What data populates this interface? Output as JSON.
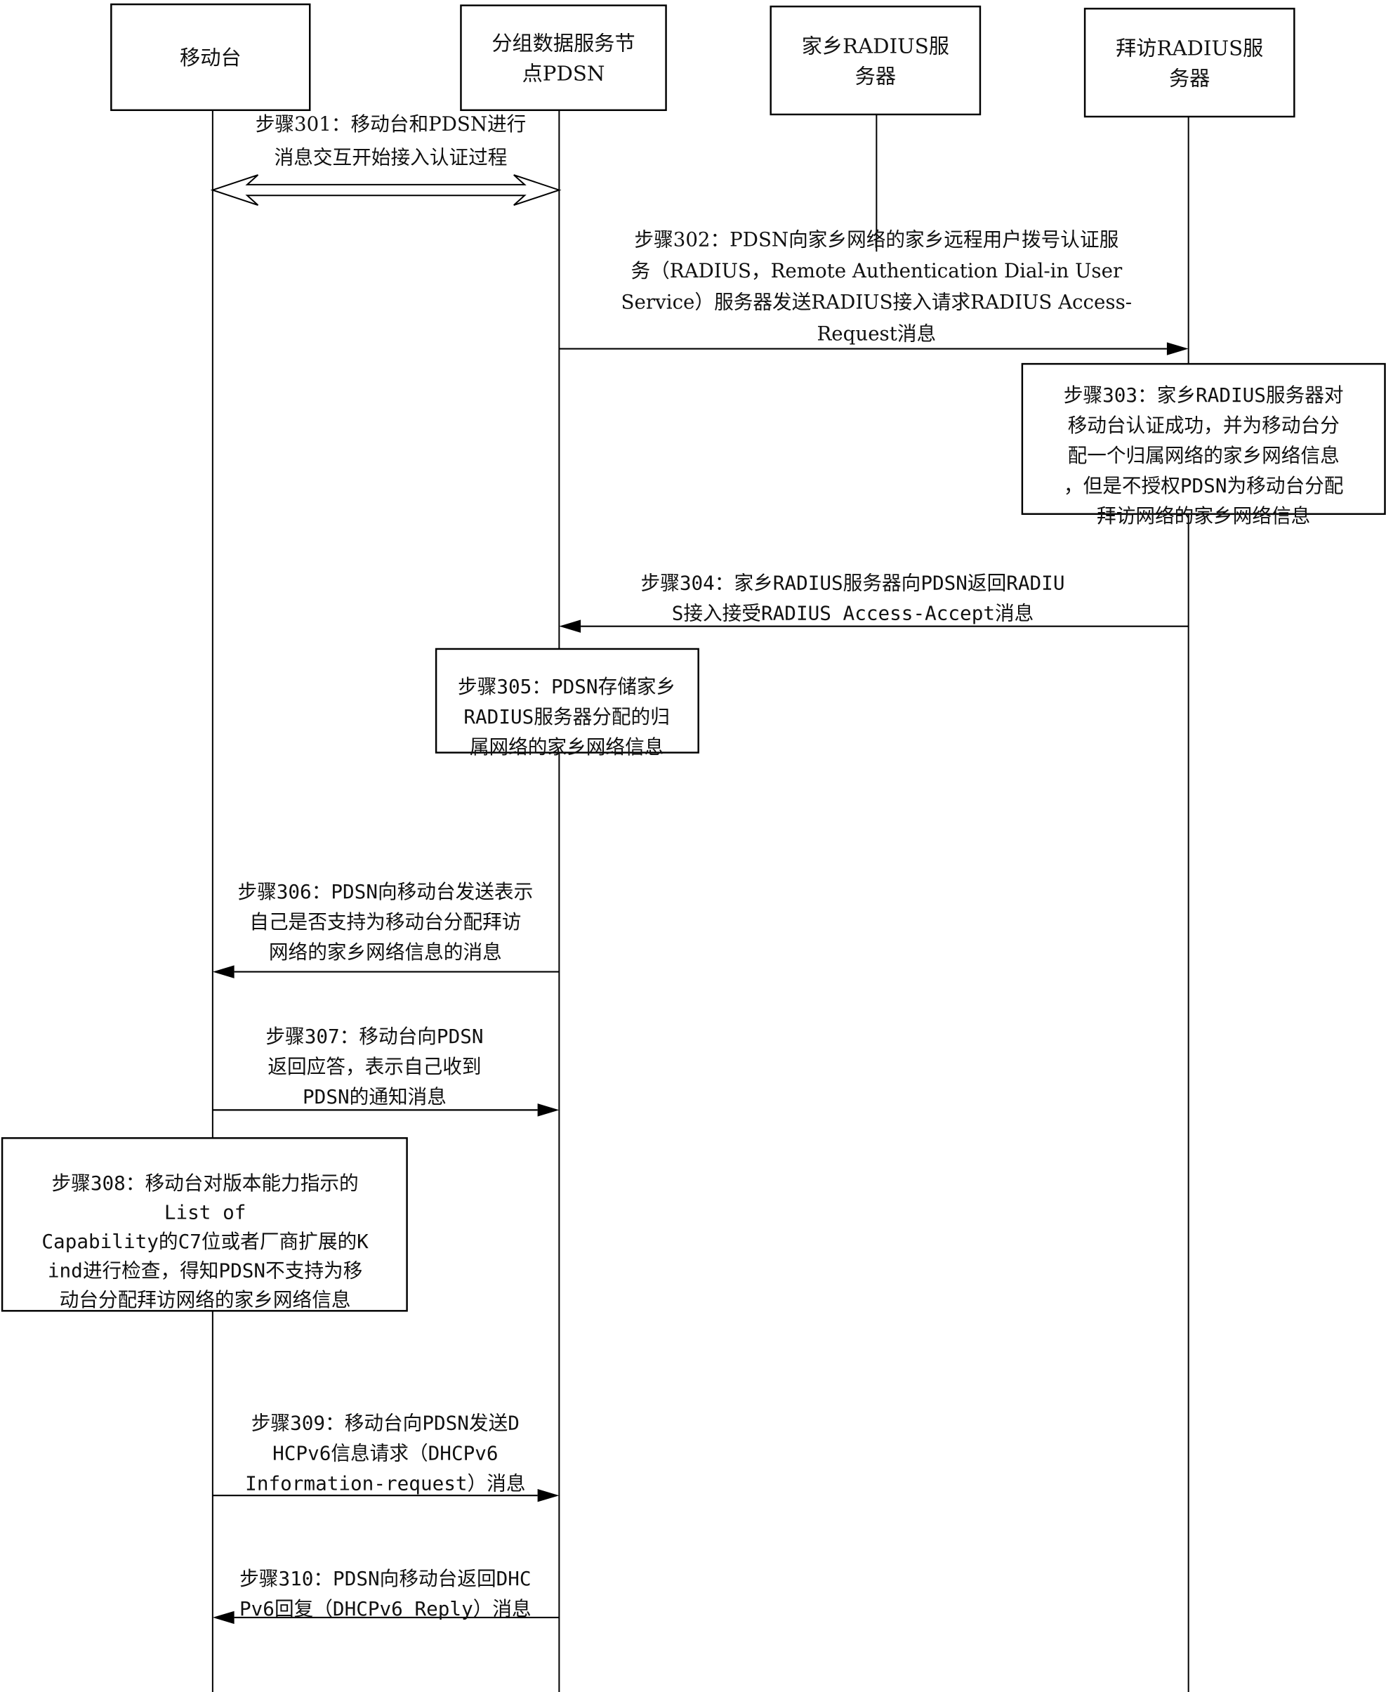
{
  "diagram": {
    "type": "sequence",
    "colors": {
      "line": "#000000",
      "background": "#ffffff",
      "text": "#111111"
    },
    "actors": [
      {
        "id": "ms",
        "lines": [
          "移动台"
        ]
      },
      {
        "id": "pdsn",
        "lines": [
          "分组数据服务节",
          "点PDSN"
        ]
      },
      {
        "id": "home",
        "lines": [
          "家乡RADIUS服",
          "务器"
        ]
      },
      {
        "id": "visited",
        "lines": [
          "拜访RADIUS服",
          "务器"
        ]
      }
    ],
    "steps": [
      {
        "id": "301",
        "kind": "message",
        "from": "ms",
        "to": "pdsn",
        "bidirectional": true,
        "lines": [
          "步骤301：移动台和PDSN进行",
          "消息交互开始接入认证过程"
        ]
      },
      {
        "id": "302",
        "kind": "message",
        "from": "pdsn",
        "to": "visited",
        "lines": [
          "步骤302：PDSN向家乡网络的家乡远程用户拨号认证服",
          "务（RADIUS，Remote Authentication Dial-in User",
          "Service）服务器发送RADIUS接入请求RADIUS Access-",
          "Request消息"
        ]
      },
      {
        "id": "303",
        "kind": "note",
        "on": "visited",
        "lines": [
          "步骤303：家乡RADIUS服务器对",
          "移动台认证成功，并为移动台分",
          "配一个归属网络的家乡网络信息",
          "，但是不授权PDSN为移动台分配",
          "拜访网络的家乡网络信息"
        ]
      },
      {
        "id": "304",
        "kind": "message",
        "from": "visited",
        "to": "pdsn",
        "lines": [
          "步骤304：家乡RADIUS服务器向PDSN返回RADIU",
          "S接入接受RADIUS Access-Accept消息"
        ]
      },
      {
        "id": "305",
        "kind": "note",
        "on": "pdsn",
        "lines": [
          "步骤305：PDSN存储家乡",
          "RADIUS服务器分配的归",
          "属网络的家乡网络信息"
        ]
      },
      {
        "id": "306",
        "kind": "message",
        "from": "pdsn",
        "to": "ms",
        "lines": [
          "步骤306：PDSN向移动台发送表示",
          "自己是否支持为移动台分配拜访",
          "网络的家乡网络信息的消息"
        ]
      },
      {
        "id": "307",
        "kind": "message",
        "from": "ms",
        "to": "pdsn",
        "lines": [
          "步骤307：移动台向PDSN",
          "返回应答，表示自己收到",
          "PDSN的通知消息"
        ]
      },
      {
        "id": "308",
        "kind": "note",
        "on": "ms",
        "lines": [
          "步骤308：移动台对版本能力指示的",
          "List of",
          "Capability的C7位或者厂商扩展的K",
          "ind进行检查，得知PDSN不支持为移",
          "动台分配拜访网络的家乡网络信息"
        ]
      },
      {
        "id": "309",
        "kind": "message",
        "from": "ms",
        "to": "pdsn",
        "lines": [
          "步骤309：移动台向PDSN发送D",
          "HCPv6信息请求（DHCPv6",
          "Information-request）消息"
        ]
      },
      {
        "id": "310",
        "kind": "message",
        "from": "pdsn",
        "to": "ms",
        "lines": [
          "步骤310：PDSN向移动台返回DHC",
          "Pv6回复（DHCPv6 Reply）消息"
        ]
      }
    ]
  }
}
